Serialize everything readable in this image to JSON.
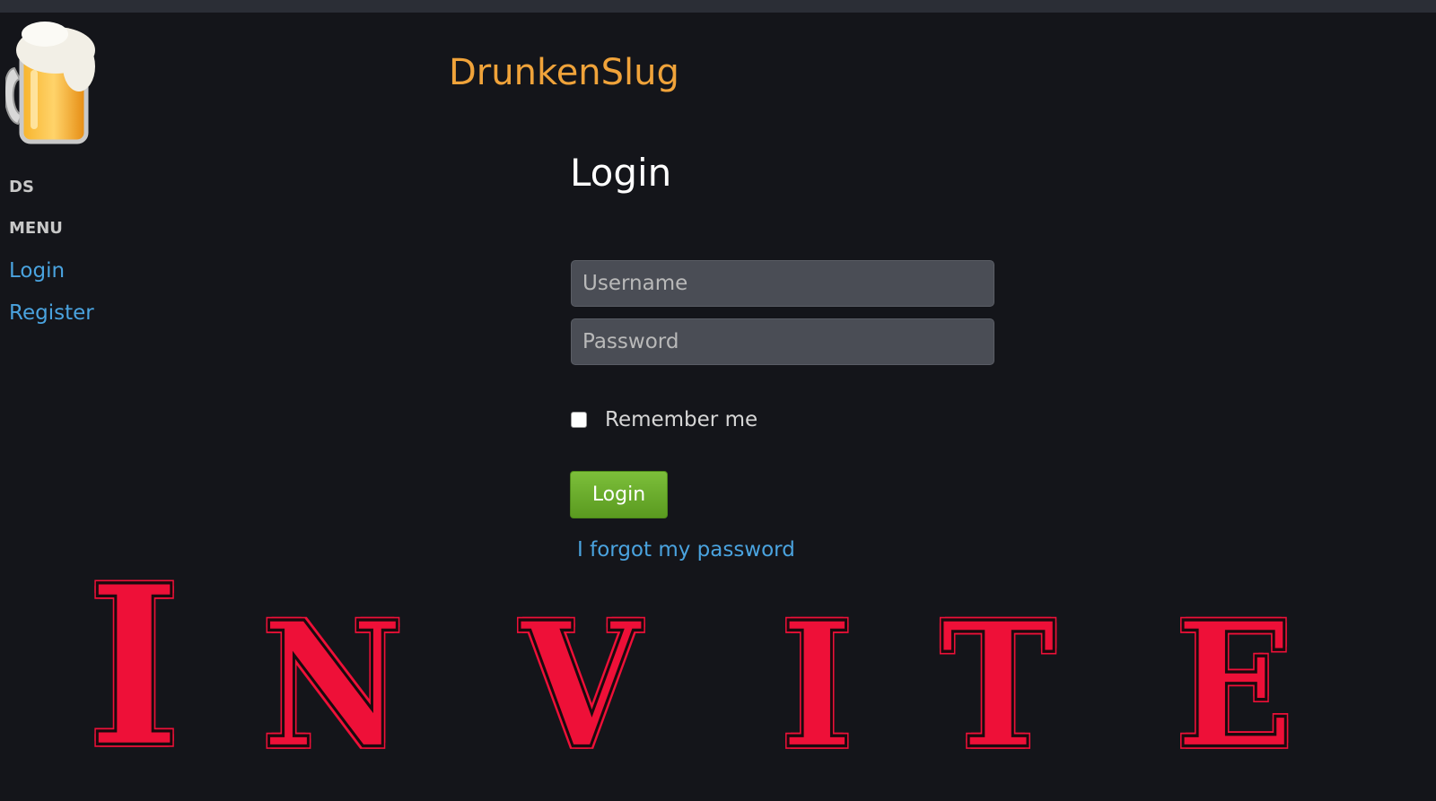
{
  "sidebar": {
    "ds_label": "DS",
    "menu_label": "MENU",
    "links": [
      {
        "label": "Login"
      },
      {
        "label": "Register"
      }
    ]
  },
  "header": {
    "brand": "DrunkenSlug"
  },
  "login": {
    "title": "Login",
    "username_placeholder": "Username",
    "password_placeholder": "Password",
    "remember_label": "Remember me",
    "submit_label": "Login",
    "forgot_label": "I forgot my password"
  },
  "banner": {
    "letters": [
      "I",
      "N",
      "V",
      "I",
      "T",
      "E"
    ]
  },
  "colors": {
    "background": "#14151a",
    "brand": "#f0a33a",
    "link": "#4aa3df",
    "button": "#6aab2b",
    "banner": "#ee1038"
  }
}
